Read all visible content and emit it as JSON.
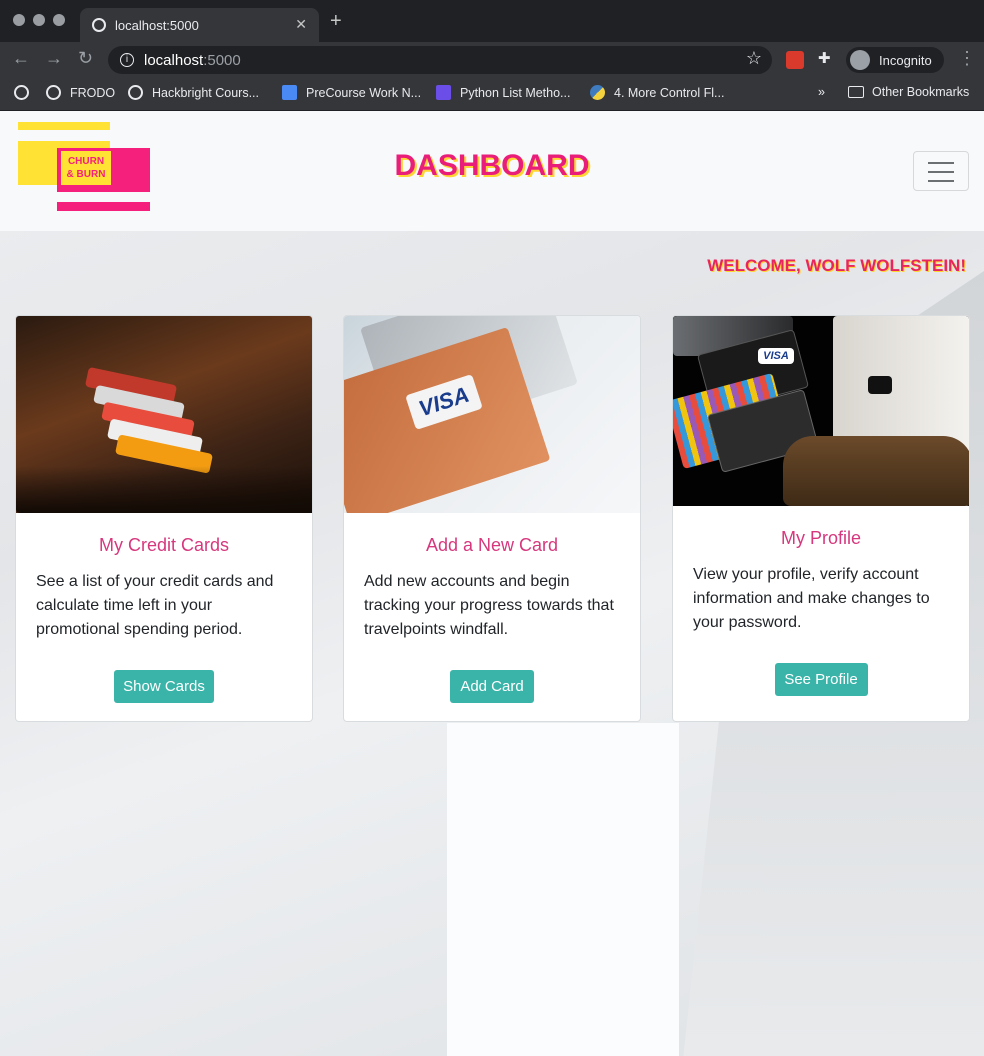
{
  "browser": {
    "tab_title": "localhost:5000",
    "new_tab": "+",
    "address_host": "localhost",
    "address_port": ":5000",
    "profile_label": "Incognito",
    "bookmarks": [
      {
        "label": ""
      },
      {
        "label": "FRODO"
      },
      {
        "label": "Hackbright Cours..."
      },
      {
        "label": "PreCourse Work N..."
      },
      {
        "label": "Python List Metho..."
      },
      {
        "label": "4. More Control Fl..."
      }
    ],
    "overflow": "»",
    "other_bookmarks": "Other Bookmarks"
  },
  "navbar": {
    "logo_text_line1": "CHURN",
    "logo_text_line2": "& BURN",
    "title": "DASHBOARD"
  },
  "welcome": "WELCOME, WOLF WOLFSTEIN!",
  "cards": [
    {
      "title": "My Credit Cards",
      "text": "See a list of your credit cards and calculate time left in your promotional spending period.",
      "button": "Show Cards"
    },
    {
      "title": "Add a New Card",
      "text": "Add new accounts and begin tracking your progress towards that travelpoints windfall.",
      "button": "Add Card",
      "image_text": "VISA"
    },
    {
      "title": "My Profile",
      "text": "View your profile, verify account information and make changes to your password.",
      "button": "See Profile",
      "image_text": "VISA"
    }
  ],
  "colors": {
    "accent_pink": "#e91e7a",
    "accent_yellow": "#ffd633",
    "button_teal": "#3ab4a8"
  }
}
